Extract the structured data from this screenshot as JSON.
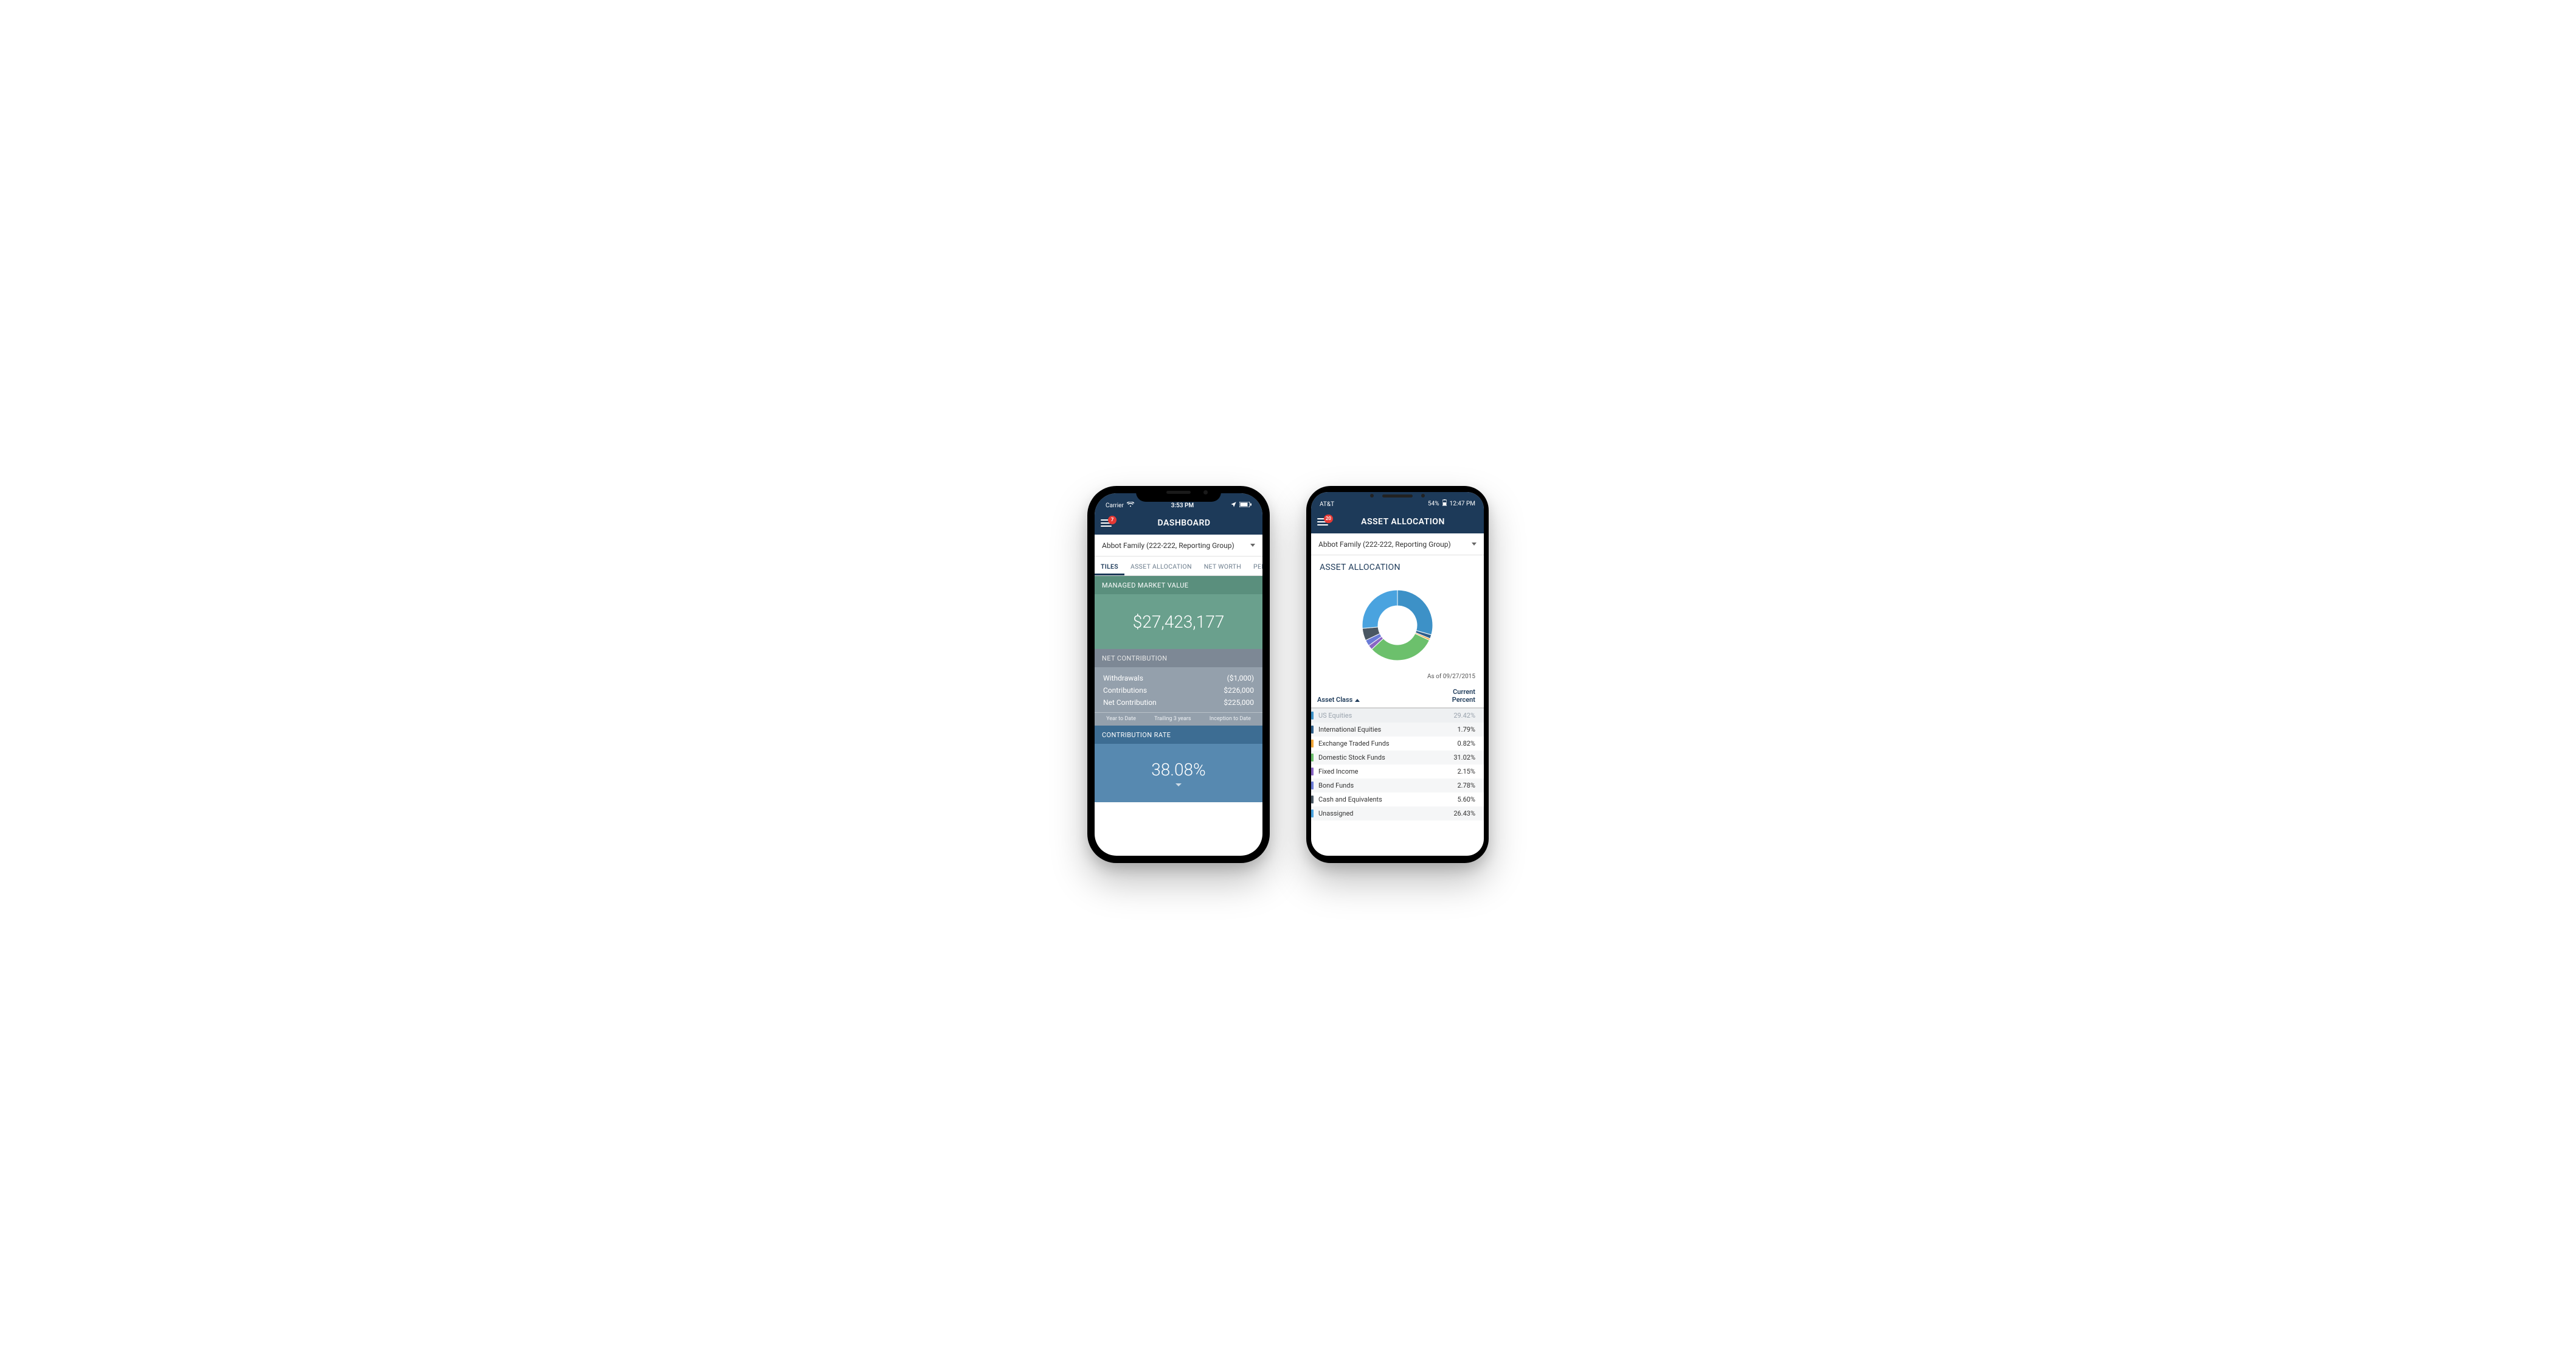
{
  "phone1": {
    "statusbar": {
      "carrier": "Carrier",
      "time": "3:53 PM"
    },
    "appbar": {
      "badge": "7",
      "title": "DASHBOARD"
    },
    "selector": {
      "label": "Abbot Family (222-222, Reporting Group)"
    },
    "tabs": [
      "TILES",
      "ASSET ALLOCATION",
      "NET WORTH",
      "PERFOR"
    ],
    "tiles": {
      "mmv": {
        "title": "MANAGED MARKET VALUE",
        "value": "$27,423,177"
      },
      "net": {
        "title": "NET CONTRIBUTION",
        "rows": [
          {
            "label": "Withdrawals",
            "value": "($1,000)"
          },
          {
            "label": "Contributions",
            "value": "$226,000"
          },
          {
            "label": "Net Contribution",
            "value": "$225,000"
          }
        ],
        "ranges": [
          "Year to Date",
          "Trailing 3 years",
          "Inception to Date"
        ]
      },
      "cr": {
        "title": "CONTRIBUTION RATE",
        "value": "38.08%"
      }
    }
  },
  "phone2": {
    "statusbar": {
      "carrier": "AT&T",
      "battery_text": "54%",
      "time": "12:47 PM"
    },
    "appbar": {
      "badge": "20",
      "title": "ASSET ALLOCATION"
    },
    "selector": {
      "label": "Abbot Family (222-222, Reporting Group)"
    },
    "section_title": "ASSET ALLOCATION",
    "as_of": "As of 09/27/2015",
    "table_headers": {
      "left": "Asset Class",
      "right_line1": "Current",
      "right_line2": "Percent"
    },
    "rows": [
      {
        "name": "US Equities",
        "pct": "29.42%",
        "color": "#3d91c7"
      },
      {
        "name": "International Equities",
        "pct": "1.79%",
        "color": "#2f5f8a"
      },
      {
        "name": "Exchange Traded Funds",
        "pct": "0.82%",
        "color": "#f0a63a"
      },
      {
        "name": "Domestic Stock Funds",
        "pct": "31.02%",
        "color": "#6cc06c"
      },
      {
        "name": "Fixed Income",
        "pct": "2.15%",
        "color": "#8a66c4"
      },
      {
        "name": "Bond Funds",
        "pct": "2.78%",
        "color": "#6a7bd6"
      },
      {
        "name": "Cash and Equivalents",
        "pct": "5.60%",
        "color": "#4a5763"
      },
      {
        "name": "Unassigned",
        "pct": "26.43%",
        "color": "#4aa3df"
      }
    ]
  },
  "chart_data": {
    "type": "pie",
    "title": "Asset Allocation",
    "series": [
      {
        "name": "US Equities",
        "value": 29.42,
        "color": "#3d91c7"
      },
      {
        "name": "International Equities",
        "value": 1.79,
        "color": "#2f5f8a"
      },
      {
        "name": "Exchange Traded Funds",
        "value": 0.82,
        "color": "#f0a63a"
      },
      {
        "name": "Domestic Stock Funds",
        "value": 31.02,
        "color": "#6cc06c"
      },
      {
        "name": "Fixed Income",
        "value": 2.15,
        "color": "#8a66c4"
      },
      {
        "name": "Bond Funds",
        "value": 2.78,
        "color": "#6a7bd6"
      },
      {
        "name": "Cash and Equivalents",
        "value": 5.6,
        "color": "#4a5763"
      },
      {
        "name": "Unassigned",
        "value": 26.43,
        "color": "#4aa3df"
      }
    ],
    "unit": "%",
    "as_of": "09/27/2015"
  }
}
